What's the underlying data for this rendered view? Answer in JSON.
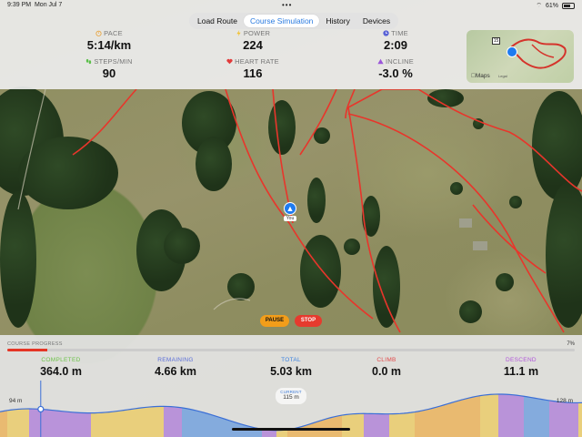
{
  "status_bar": {
    "time": "9:39 PM",
    "date": "Mon Jul 7",
    "battery": "61%"
  },
  "tabs": [
    {
      "label": "Load Route",
      "active": false
    },
    {
      "label": "Course Simulation",
      "active": true
    },
    {
      "label": "History",
      "active": false
    },
    {
      "label": "Devices",
      "active": false
    }
  ],
  "stats": {
    "pace": {
      "label": "PACE",
      "value": "5:14/km",
      "icon": "stopwatch-icon",
      "color": "#e8a33b"
    },
    "power": {
      "label": "POWER",
      "value": "224",
      "icon": "bolt-icon",
      "color": "#f2c230"
    },
    "time": {
      "label": "TIME",
      "value": "2:09",
      "icon": "clock-icon",
      "color": "#5a63d6"
    },
    "steps": {
      "label": "STEPS/MIN",
      "value": "90",
      "icon": "footsteps-icon",
      "color": "#5bbf4a"
    },
    "heart_rate": {
      "label": "HEART RATE",
      "value": "116",
      "icon": "heart-icon",
      "color": "#e23b3b"
    },
    "incline": {
      "label": "INCLINE",
      "value": "-3.0 %",
      "icon": "triangle-icon",
      "color": "#9b55d9"
    }
  },
  "minimap": {
    "brand": "Maps",
    "legal": "Legal",
    "route_number": "15"
  },
  "runner": {
    "tag": "You"
  },
  "controls": {
    "pause": "PAUSE",
    "stop": "STOP"
  },
  "progress": {
    "label": "COURSE PROGRESS",
    "percent_text": "7%",
    "fraction": 0.07
  },
  "bottom_stats": {
    "completed": {
      "label": "COMPLETED",
      "value": "364.0 m",
      "color": "#6dc24a"
    },
    "remaining": {
      "label": "REMAINING",
      "value": "4.66 km",
      "color": "#5b6fd9"
    },
    "total": {
      "label": "TOTAL",
      "value": "5.03 km",
      "color": "#3b82e0"
    },
    "climb": {
      "label": "CLIMB",
      "value": "0.0 m",
      "color": "#e24a4a"
    },
    "descend": {
      "label": "DESCEND",
      "value": "11.1 m",
      "color": "#b055d9"
    }
  },
  "elevation": {
    "start": "94 m",
    "end": "128 m",
    "current_label": "CURRENT",
    "current_value": "115 m"
  },
  "colors": {
    "route": "#e8352b",
    "accent": "#2a7be0"
  }
}
